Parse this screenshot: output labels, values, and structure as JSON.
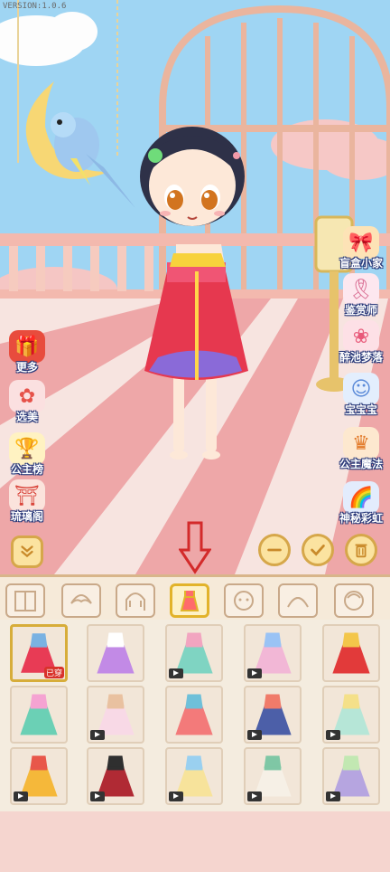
{
  "version": "VERSION:1.0.6",
  "left_menu": [
    {
      "label": "更多",
      "icon": "gift-icon",
      "color": "#e84c3d"
    },
    {
      "label": "选美",
      "icon": "fan-icon",
      "color": "#e6524a"
    },
    {
      "label": "公主榜",
      "icon": "trophy-icon",
      "color": "#f1c21e"
    },
    {
      "label": "琉璃阁",
      "icon": "pavilion-icon",
      "color": "#d9453b"
    }
  ],
  "right_menu": [
    {
      "label": "盲盒小家",
      "icon": "blind-box-icon",
      "color": "#f3a23a"
    },
    {
      "label": "鉴赏师",
      "icon": "ribbon-icon",
      "color": "#f2c2d2"
    },
    {
      "label": "醉池梦落",
      "icon": "flower-icon",
      "color": "#f08aa0"
    },
    {
      "label": "宝宝宝",
      "icon": "baby-icon",
      "color": "#9ac0f0"
    },
    {
      "label": "公主魔法",
      "icon": "princess-icon",
      "color": "#f0a050"
    },
    {
      "label": "神秘彩虹",
      "icon": "rainbow-icon",
      "color": "#8ab0f0"
    }
  ],
  "actions": {
    "collapse": "chevron-collapse-icon",
    "minus": "minus-icon",
    "confirm": "check-icon",
    "delete": "trash-icon"
  },
  "tabs": [
    {
      "name": "tab-background",
      "icon": "door-icon"
    },
    {
      "name": "tab-bangs",
      "icon": "bangs-icon"
    },
    {
      "name": "tab-back-hair",
      "icon": "hair-icon"
    },
    {
      "name": "tab-dress",
      "icon": "dress-icon",
      "active": true
    },
    {
      "name": "tab-face",
      "icon": "face-icon"
    },
    {
      "name": "tab-hat",
      "icon": "hat-icon"
    },
    {
      "name": "tab-head",
      "icon": "head-icon"
    }
  ],
  "items": [
    {
      "color": "#e83b55",
      "accent": "#7ab2e2",
      "locked": false,
      "badge": "已穿",
      "selected": true
    },
    {
      "color": "#c28ae6",
      "accent": "#ffffff",
      "locked": false
    },
    {
      "color": "#7fd4c2",
      "accent": "#f2a5c0",
      "locked": true
    },
    {
      "color": "#f2b7d6",
      "accent": "#9ac3f5",
      "locked": true
    },
    {
      "color": "#e23a3a",
      "accent": "#f3c64a",
      "locked": false
    },
    {
      "color": "#6bd0b5",
      "accent": "#f5a3d2",
      "locked": false
    },
    {
      "color": "#f8d9e6",
      "accent": "#e9c1a0",
      "locked": true
    },
    {
      "color": "#f37a7a",
      "accent": "#6fc0d9",
      "locked": false
    },
    {
      "color": "#4c5fa8",
      "accent": "#f07b6a",
      "locked": true
    },
    {
      "color": "#b6e6d7",
      "accent": "#f4e089",
      "locked": true
    },
    {
      "color": "#f5b83a",
      "accent": "#e8574a",
      "locked": true
    },
    {
      "color": "#b02a34",
      "accent": "#2f2f2f",
      "locked": true
    },
    {
      "color": "#f7e39b",
      "accent": "#9ad0f0",
      "locked": true
    },
    {
      "color": "#f6f0e6",
      "accent": "#7fc7a5",
      "locked": true
    },
    {
      "color": "#b6a5e0",
      "accent": "#c2e8b2",
      "locked": true
    }
  ],
  "highlight_arrow": "down-arrow-icon"
}
